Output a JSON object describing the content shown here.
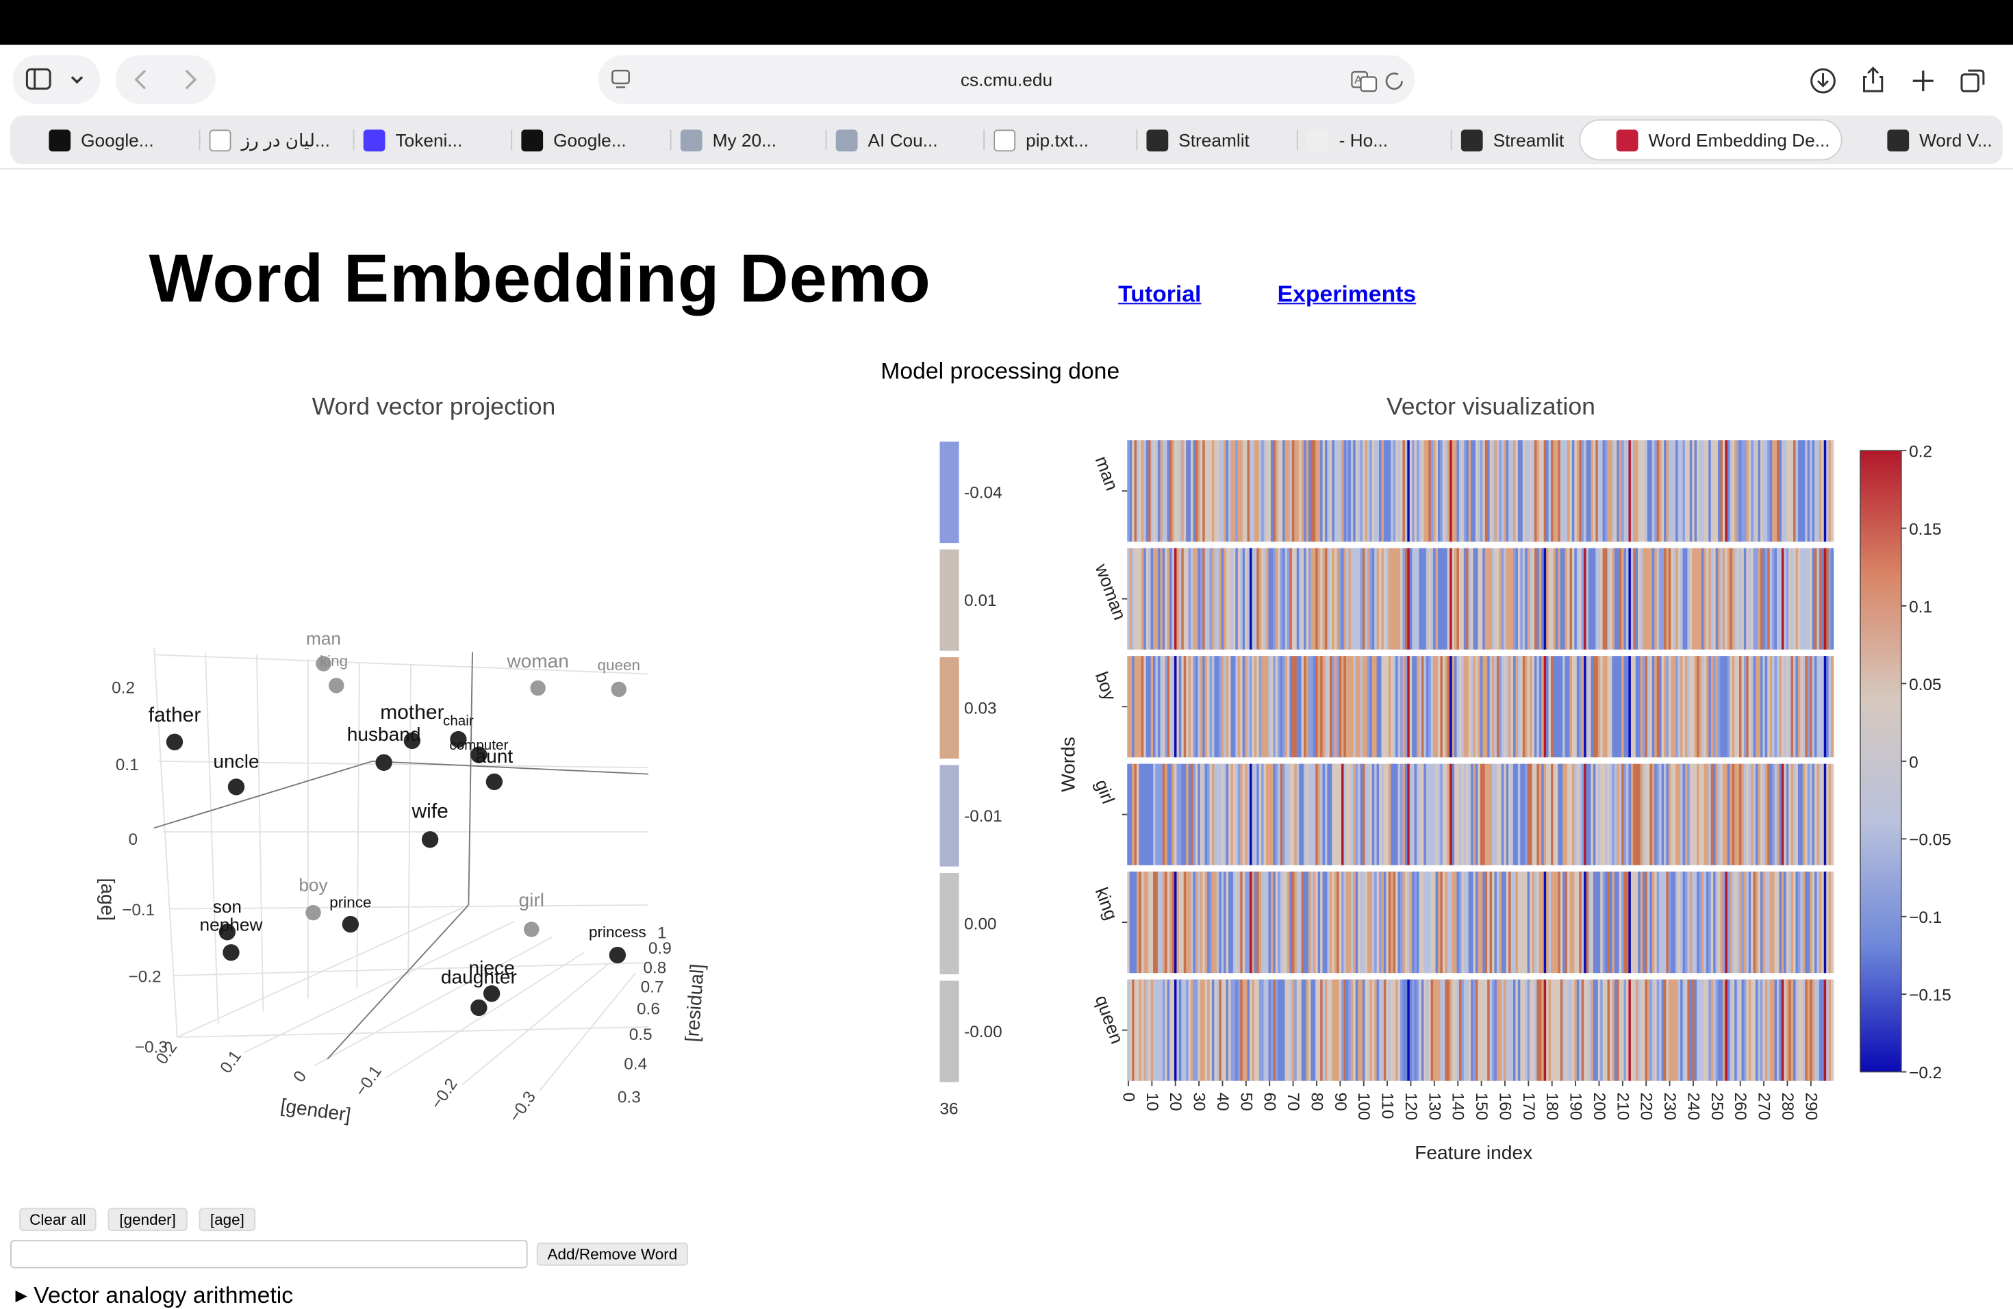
{
  "browser": {
    "url": "cs.cmu.edu",
    "tabs": [
      {
        "label": "Google...",
        "icon": "notebook-icon",
        "color": "#111111"
      },
      {
        "label": "لیان در رز...",
        "icon": "openai-icon",
        "color": "#ffffff"
      },
      {
        "label": "Tokeni...",
        "icon": "tokenizer-icon",
        "color": "#4b3bff"
      },
      {
        "label": "Google...",
        "icon": "notebook-icon",
        "color": "#111111"
      },
      {
        "label": "My 20...",
        "icon": "avatar-icon",
        "color": "#9aa6b8"
      },
      {
        "label": "AI Cou...",
        "icon": "avatar-icon",
        "color": "#9aa6b8"
      },
      {
        "label": "pip.txt...",
        "icon": "google-drive-icon",
        "color": "#ffffff"
      },
      {
        "label": "Streamlit",
        "icon": "streamlit-icon",
        "color": "#2b2b2b"
      },
      {
        "label": "- Ho...",
        "icon": "page-icon",
        "color": "#eeeeee"
      },
      {
        "label": "Streamlit",
        "icon": "streamlit-icon",
        "color": "#2b2b2b"
      },
      {
        "label": "Word Embedding De...",
        "icon": "cmu-dragon-icon",
        "color": "#c41e3a",
        "active": true
      },
      {
        "label": "Word V...",
        "icon": "streamlit-icon",
        "color": "#2b2b2b"
      }
    ]
  },
  "page": {
    "title": "Word Embedding Demo",
    "links": {
      "tutorial": "Tutorial",
      "experiments": "Experiments"
    },
    "status": "Model processing done"
  },
  "projection": {
    "title": "Word vector projection",
    "axes": {
      "x": "[gender]",
      "y": "[residual]",
      "z": "[age]"
    },
    "z_ticks": [
      "0.2",
      "0.1",
      "0",
      "−0.1",
      "−0.2",
      "−0.3"
    ],
    "x_ticks": [
      "0.2",
      "0.1",
      "0",
      "−0.1",
      "−0.2",
      "−0.3"
    ],
    "y_ticks": [
      "1",
      "0.9",
      "0.8",
      "0.7",
      "0.6",
      "0.5",
      "0.4",
      "0.3"
    ],
    "words": [
      {
        "word": "man",
        "style": "gray"
      },
      {
        "word": "king",
        "style": "gray"
      },
      {
        "word": "woman",
        "style": "gray"
      },
      {
        "word": "queen",
        "style": "gray"
      },
      {
        "word": "boy",
        "style": "gray"
      },
      {
        "word": "girl",
        "style": "gray"
      },
      {
        "word": "father",
        "style": "dark"
      },
      {
        "word": "uncle",
        "style": "dark"
      },
      {
        "word": "mother",
        "style": "dark"
      },
      {
        "word": "husband",
        "style": "dark"
      },
      {
        "word": "chair",
        "style": "dark"
      },
      {
        "word": "computer",
        "style": "dark"
      },
      {
        "word": "aunt",
        "style": "dark"
      },
      {
        "word": "wife",
        "style": "dark"
      },
      {
        "word": "son",
        "style": "dark"
      },
      {
        "word": "nephew",
        "style": "dark"
      },
      {
        "word": "prince",
        "style": "dark"
      },
      {
        "word": "princess",
        "style": "dark"
      },
      {
        "word": "niece",
        "style": "dark"
      },
      {
        "word": "daughter",
        "style": "dark"
      }
    ]
  },
  "side_bars": {
    "values": [
      "-0.04",
      "0.01",
      "0.03",
      "-0.01",
      "0.00",
      "-0.00"
    ],
    "colors": [
      "#8b9be0",
      "#c9bfb8",
      "#d6a88a",
      "#acb3d0",
      "#c4c4c4",
      "#c2c2c2"
    ],
    "axis_label": "36"
  },
  "chart_data": {
    "type": "heatmap",
    "title": "Vector visualization",
    "xlabel": "Feature index",
    "ylabel": "Words",
    "rows": [
      "man",
      "woman",
      "boy",
      "girl",
      "king",
      "queen"
    ],
    "x_ticks": [
      0,
      10,
      20,
      30,
      40,
      50,
      60,
      70,
      80,
      90,
      100,
      110,
      120,
      130,
      140,
      150,
      160,
      170,
      180,
      190,
      200,
      210,
      220,
      230,
      240,
      250,
      260,
      270,
      280,
      290
    ],
    "x_range": [
      0,
      299
    ],
    "colorbar": {
      "ticks": [
        "0.2",
        "0.15",
        "0.1",
        "0.05",
        "0",
        "−0.05",
        "−0.1",
        "−0.15",
        "−0.2"
      ],
      "range": [
        -0.2,
        0.2
      ],
      "colors": [
        "#b2182b",
        "#d98566",
        "#d6c8be",
        "#b9c1dc",
        "#6d86d9",
        "#0a0ab4"
      ]
    }
  },
  "controls": {
    "clear_all": "Clear all",
    "gender": "[gender]",
    "age": "[age]",
    "add_remove": "Add/Remove Word",
    "word_input_value": "",
    "analogy": "Vector analogy arithmetic"
  }
}
